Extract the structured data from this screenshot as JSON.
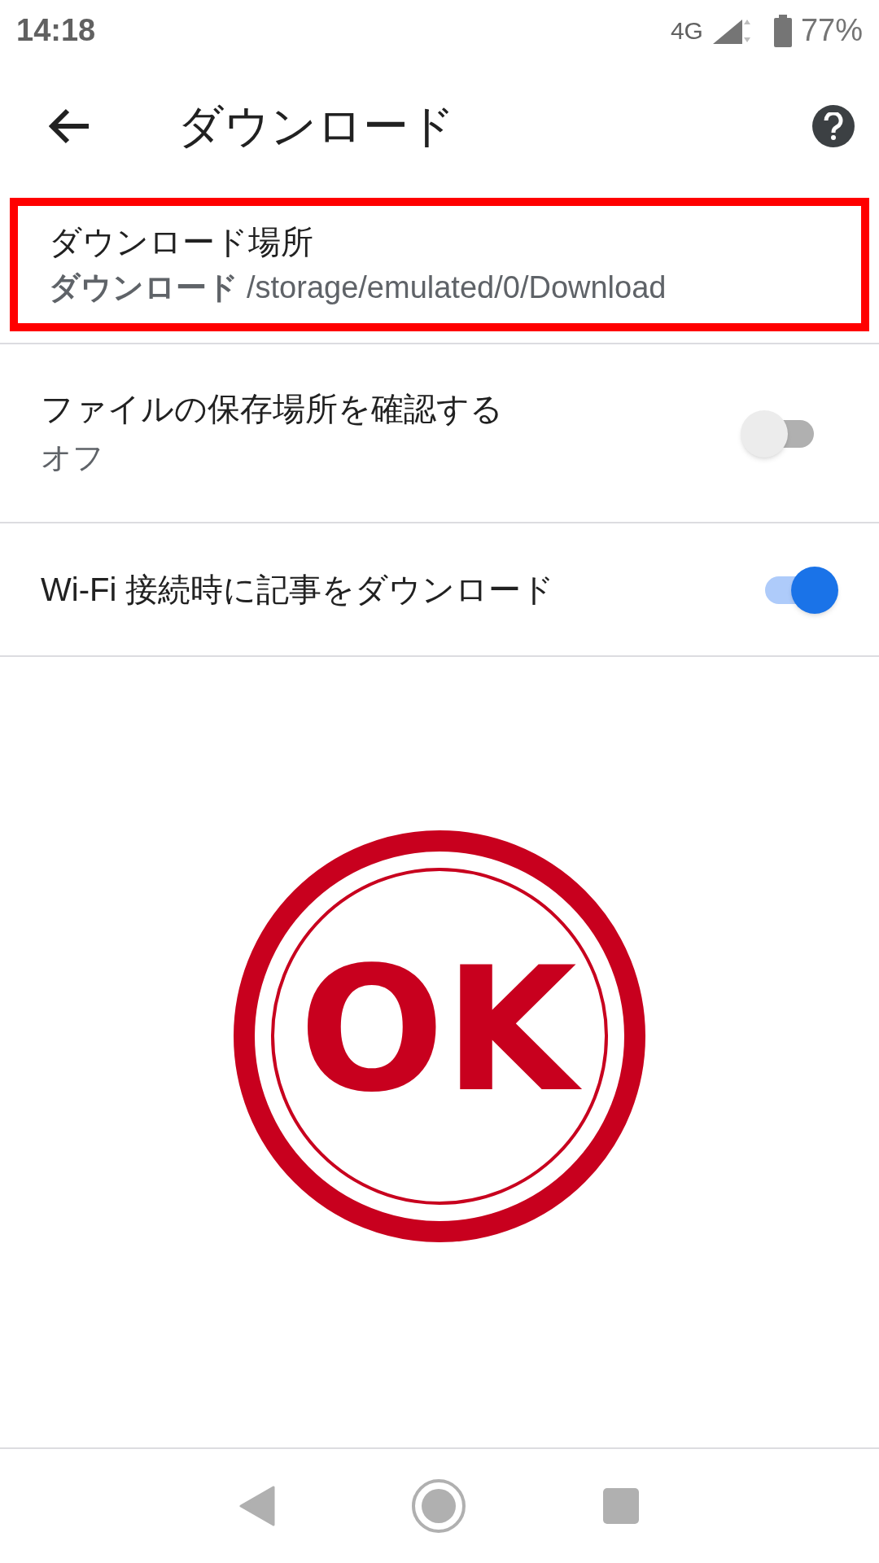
{
  "status_bar": {
    "time": "14:18",
    "network": "4G",
    "battery": "77%"
  },
  "app_bar": {
    "title": "ダウンロード"
  },
  "settings": [
    {
      "kind": "location",
      "title": "ダウンロード場所",
      "subtitle_bold": "ダウンロード",
      "subtitle": "/storage/emulated/0/Download",
      "highlighted": true
    },
    {
      "kind": "toggle",
      "title": "ファイルの保存場所を確認する",
      "subtitle": "オフ",
      "on": false
    },
    {
      "kind": "toggle",
      "title": "Wi-Fi 接続時に記事をダウンロード",
      "on": true
    }
  ],
  "stamp": {
    "text": "OK"
  }
}
